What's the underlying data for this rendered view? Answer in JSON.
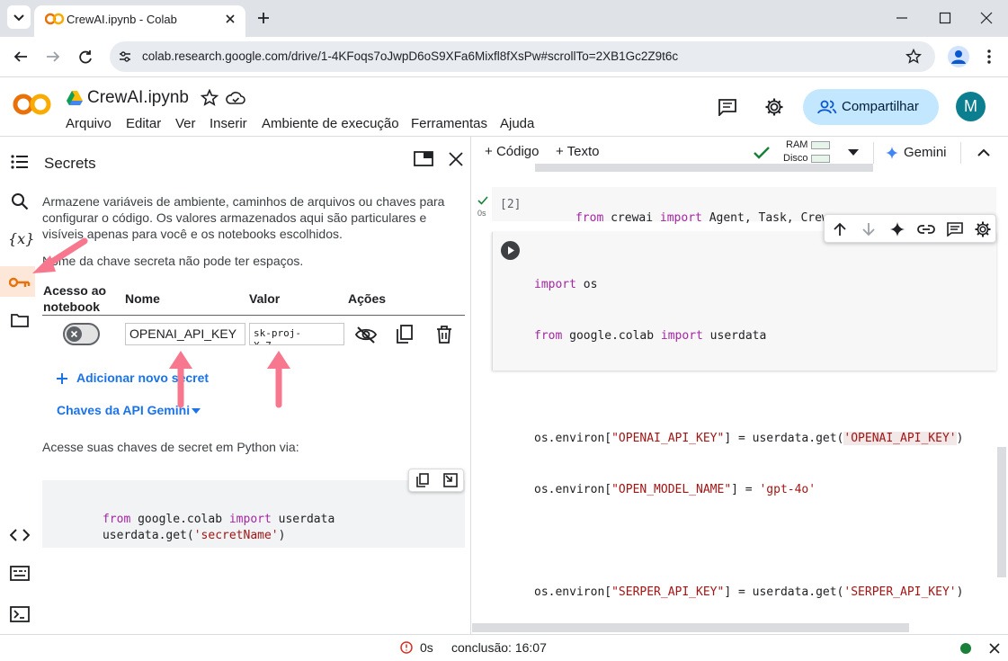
{
  "browser": {
    "tab_title": "CrewAI.ipynb - Colab",
    "url": "colab.research.google.com/drive/1-4KFoqs7oJwpD6oS9XFa6Mixfl8fXsPw#scrollTo=2XB1Gc2Z9t6c"
  },
  "header": {
    "logo_text": "CO",
    "notebook_title": "CrewAI.ipynb",
    "share_label": "Compartilhar",
    "avatar_letter": "M",
    "menu": [
      "Arquivo",
      "Editar",
      "Ver",
      "Inserir",
      "Ambiente de execução",
      "Ferramentas",
      "Ajuda"
    ]
  },
  "secrets": {
    "title": "Secrets",
    "description": "Armazene variáveis de ambiente, caminhos de arquivos ou chaves para configurar o código. Os valores armazenados aqui são particulares e visíveis apenas para você e os notebooks escolhidos.",
    "warning": "Nome da chave secreta não pode ter espaços.",
    "columns": {
      "access": "Acesso ao notebook",
      "name": "Nome",
      "value": "Valor",
      "actions": "Ações"
    },
    "row": {
      "name": "OPENAI_API_KEY",
      "value": "sk-proj-\nX_7...",
      "access_enabled": false
    },
    "add_label": "Adicionar novo secret",
    "gemini_keys_label": "Chaves da API Gemini",
    "access_hint": "Acesse suas chaves de secret em Python via:",
    "snippet_line1_kw1": "from",
    "snippet_line1_mid": " google.colab ",
    "snippet_line1_kw2": "import",
    "snippet_line1_end": " userdata",
    "snippet_line2_pre": "userdata.get(",
    "snippet_line2_str": "'secretName'",
    "snippet_line2_end": ")"
  },
  "toolbar": {
    "code_label": "Código",
    "text_label": "Texto",
    "ram_label": "RAM",
    "disk_label": "Disco",
    "gemini_label": "Gemini"
  },
  "cell1": {
    "exec_count": "[2]",
    "exec_time": "0s",
    "code_kw1": "from",
    "code_mid": " crewai ",
    "code_kw2": "import",
    "code_end": " Agent, Task, Crew"
  },
  "cell2": {
    "l1_kw": "import",
    "l1_end": " os",
    "l2_kw1": "from",
    "l2_mid": " google.colab ",
    "l2_kw2": "import",
    "l2_end": " userdata",
    "l3_pre": "os.environ[",
    "l3_key": "\"OPENAI_API_KEY\"",
    "l3_mid": "] = userdata.get(",
    "l3_arg": "'OPENAI_API_KEY'",
    "l3_end": ")",
    "l4_pre": "os.environ[",
    "l4_key": "\"OPEN_MODEL_NAME\"",
    "l4_mid": "] = ",
    "l4_val": "'gpt-4o'",
    "l5_pre": "os.environ[",
    "l5_key": "\"SERPER_API_KEY\"",
    "l5_mid": "] = userdata.get(",
    "l5_arg": "'SERPER_API_KEY'",
    "l5_end": ")"
  },
  "status": {
    "time": "0s",
    "completion": "conclusão: 16:07"
  },
  "colors": {
    "accent_blue": "#1a73e8",
    "share_bg": "#c2e7ff",
    "avatar_bg": "#0b7f8f",
    "annotation_pink": "#f7778e",
    "keyword": "#a626a4",
    "string": "#a31515"
  }
}
